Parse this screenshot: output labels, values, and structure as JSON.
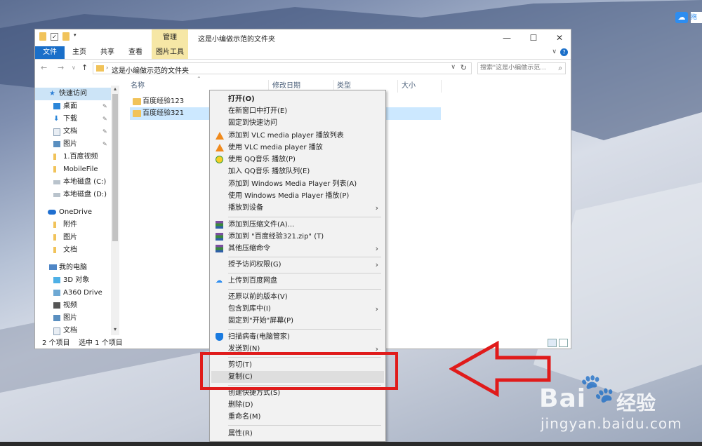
{
  "window": {
    "title": "这是小编做示范的文件夹",
    "manage_tab": "管理",
    "picture_tools_tab": "图片工具",
    "ribbon_tabs": [
      "文件",
      "主页",
      "共享",
      "查看"
    ],
    "minimize": "—",
    "maximize": "☐",
    "close": "✕",
    "help": "?"
  },
  "address": {
    "path": "这是小编做示范的文件夹",
    "search_placeholder": "搜索\"这是小编做示范...",
    "back": "←",
    "forward": "→",
    "up": "↑"
  },
  "navpane": {
    "items": [
      {
        "label": "快速访问",
        "icon": "star-icon"
      },
      {
        "label": "桌面",
        "icon": "desktop-icon"
      },
      {
        "label": "下载",
        "icon": "download-icon"
      },
      {
        "label": "文档",
        "icon": "document-icon"
      },
      {
        "label": "图片",
        "icon": "picture-icon"
      },
      {
        "label": "1.百度视频",
        "icon": "folder-icon"
      },
      {
        "label": "MobileFile",
        "icon": "folder-icon"
      },
      {
        "label": "本地磁盘 (C:)",
        "icon": "drive-icon"
      },
      {
        "label": "本地磁盘 (D:)",
        "icon": "drive-icon"
      },
      {
        "label": "OneDrive",
        "icon": "cloud-icon"
      },
      {
        "label": "附件",
        "icon": "folder-icon"
      },
      {
        "label": "图片",
        "icon": "folder-icon"
      },
      {
        "label": "文档",
        "icon": "folder-icon"
      },
      {
        "label": "我的电脑",
        "icon": "computer-icon"
      },
      {
        "label": "3D 对象",
        "icon": "cube-icon"
      },
      {
        "label": "A360 Drive",
        "icon": "drive-icon"
      },
      {
        "label": "视频",
        "icon": "video-icon"
      },
      {
        "label": "图片",
        "icon": "picture-icon"
      },
      {
        "label": "文档",
        "icon": "document-icon"
      }
    ]
  },
  "columns": [
    "名称",
    "修改日期",
    "类型",
    "大小"
  ],
  "files": [
    {
      "name": "百度经验123",
      "selected": false
    },
    {
      "name": "百度经验321",
      "selected": true
    }
  ],
  "status": {
    "count": "2 个项目",
    "selected": "选中 1 个项目"
  },
  "context_menu": {
    "items": [
      {
        "label": "打开(O)",
        "bold": true
      },
      {
        "label": "在新窗口中打开(E)"
      },
      {
        "label": "固定到快速访问"
      },
      {
        "label": "添加到 VLC media player 播放列表",
        "icon": "vlc-icon"
      },
      {
        "label": "使用 VLC media player 播放",
        "icon": "vlc-icon"
      },
      {
        "label": "使用 QQ音乐 播放(P)",
        "icon": "qqmusic-icon"
      },
      {
        "label": "加入 QQ音乐 播放队列(E)"
      },
      {
        "label": "添加到 Windows Media Player 列表(A)"
      },
      {
        "label": "使用 Windows Media Player 播放(P)"
      },
      {
        "label": "播放到设备",
        "submenu": true
      },
      {
        "label": "添加到压缩文件(A)...",
        "icon": "winrar-icon"
      },
      {
        "label": "添加到 \"百度经验321.zip\" (T)",
        "icon": "winrar-icon"
      },
      {
        "label": "其他压缩命令",
        "icon": "winrar-icon",
        "submenu": true
      },
      {
        "label": "授予访问权限(G)",
        "submenu": true
      },
      {
        "label": "上传到百度网盘",
        "icon": "baidu-cloud-icon"
      },
      {
        "label": "还原以前的版本(V)"
      },
      {
        "label": "包含到库中(I)",
        "submenu": true
      },
      {
        "label": "固定到\"开始\"屏幕(P)"
      },
      {
        "label": "扫描病毒(电脑管家)",
        "icon": "shield-icon"
      },
      {
        "label": "发送到(N)",
        "submenu": true
      },
      {
        "label": "剪切(T)"
      },
      {
        "label": "复制(C)",
        "highlighted": true
      },
      {
        "label": "创建快捷方式(S)"
      },
      {
        "label": "删除(D)"
      },
      {
        "label": "重命名(M)"
      },
      {
        "label": "属性(R)"
      }
    ]
  },
  "watermark": {
    "brand": "Bai",
    "brand2": "经验",
    "url": "jingyan.baidu.com"
  },
  "colors": {
    "accent": "#1a6fc9",
    "highlight_box": "#e01b1b",
    "arrow": "#e01b1b"
  }
}
